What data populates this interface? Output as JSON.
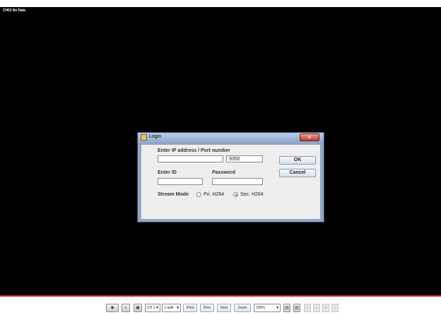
{
  "status_overlay": "CH01 No Data",
  "dialog": {
    "title": "Login",
    "close_glyph": "x",
    "ip_label": "Enter IP address / Port number",
    "ip_value": "",
    "port_value": "9350",
    "id_label": "Enter ID",
    "id_value": "",
    "password_label": "Password",
    "password_value": "",
    "ok_label": "OK",
    "cancel_label": "Cancel",
    "stream_mode_label": "Stream Mode",
    "stream_options": [
      "Pri. H264",
      "Sec. H264"
    ],
    "stream_selected": "Sec. H264"
  },
  "toolbar": {
    "channel": "CH 1",
    "split": "1-split",
    "print": "Print",
    "prev": "Prev",
    "next": "Next",
    "zoom": "Zoom",
    "zoom_level": "100%",
    "icons": [
      "record-icon",
      "search-icon",
      "snapshot-icon",
      "disk-icon",
      "storage-icon"
    ]
  },
  "colors": {
    "video_background": "#000000",
    "accent_line": "#e02020",
    "dialog_frame": "#8fa6c5",
    "close_button": "#c0402a"
  }
}
